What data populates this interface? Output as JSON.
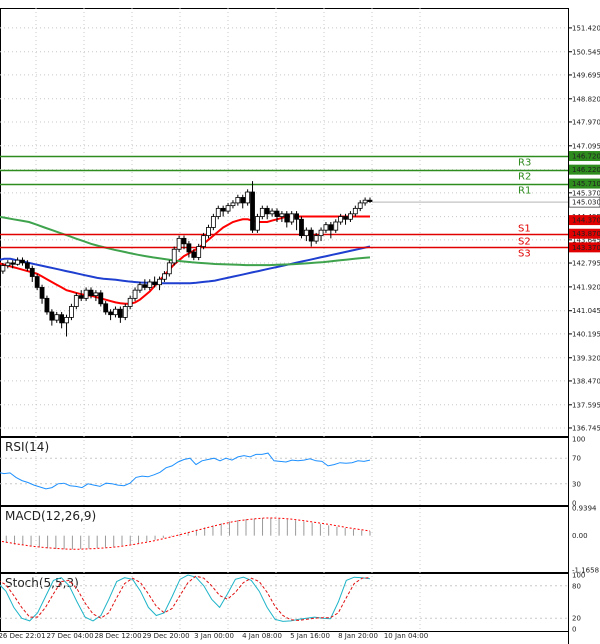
{
  "chart_data": [
    {
      "type": "candlestick",
      "y_ticks": [
        "151.420",
        "150.545",
        "149.695",
        "148.820",
        "147.970",
        "147.095",
        "146.220",
        "145.370",
        "144.495",
        "143.645",
        "142.795",
        "141.920",
        "141.045",
        "140.195",
        "139.320",
        "138.470",
        "137.595",
        "136.745"
      ],
      "ylim": [
        136.45,
        152.15
      ],
      "x_ticks": [
        "26 Dec 22:01",
        "27 Dec 04:00",
        "28 Dec 12:00",
        "29 Dec 20:00",
        "3 Jan 00:00",
        "4 Jan 08:00",
        "5 Jan 16:00",
        "8 Jan 20:00",
        "10 Jan 04:00"
      ],
      "candles": [
        [
          142.6,
          142.3,
          142.7,
          142.2
        ],
        [
          142.5,
          142.7,
          142.8,
          142.4
        ],
        [
          142.7,
          142.8,
          142.9,
          142.6
        ],
        [
          142.8,
          142.75,
          142.9,
          142.6
        ],
        [
          142.75,
          142.9,
          143.0,
          142.7
        ],
        [
          142.9,
          142.8,
          143.0,
          142.7
        ],
        [
          142.8,
          142.6,
          142.9,
          142.5
        ],
        [
          142.6,
          142.3,
          142.7,
          142.1
        ],
        [
          142.3,
          141.9,
          142.4,
          141.8
        ],
        [
          141.9,
          141.5,
          142.0,
          141.3
        ],
        [
          141.5,
          141.0,
          141.6,
          140.9
        ],
        [
          141.0,
          140.7,
          141.1,
          140.5
        ],
        [
          140.7,
          140.9,
          141.0,
          140.6
        ],
        [
          140.9,
          140.6,
          141.0,
          140.4
        ],
        [
          140.6,
          140.8,
          140.9,
          140.1
        ],
        [
          140.8,
          141.2,
          141.3,
          140.7
        ],
        [
          141.2,
          141.6,
          141.7,
          141.1
        ],
        [
          141.6,
          141.5,
          141.8,
          141.4
        ],
        [
          141.5,
          141.8,
          141.9,
          141.4
        ],
        [
          141.8,
          141.6,
          141.9,
          141.5
        ],
        [
          141.6,
          141.7,
          141.8,
          141.4
        ],
        [
          141.7,
          141.3,
          141.8,
          141.2
        ],
        [
          141.3,
          141.0,
          141.4,
          140.9
        ],
        [
          141.0,
          140.9,
          141.1,
          140.7
        ],
        [
          140.9,
          141.1,
          141.2,
          140.8
        ],
        [
          141.1,
          140.8,
          141.2,
          140.6
        ],
        [
          140.8,
          141.2,
          141.3,
          140.7
        ],
        [
          141.2,
          141.5,
          141.6,
          141.1
        ],
        [
          141.5,
          141.8,
          141.9,
          141.4
        ],
        [
          141.8,
          142.0,
          142.1,
          141.7
        ],
        [
          142.0,
          141.9,
          142.2,
          141.8
        ],
        [
          141.9,
          142.1,
          142.2,
          141.8
        ],
        [
          142.1,
          142.0,
          142.3,
          141.9
        ],
        [
          142.0,
          142.2,
          142.3,
          141.8
        ],
        [
          142.2,
          142.4,
          142.5,
          142.1
        ],
        [
          142.4,
          142.8,
          142.9,
          142.3
        ],
        [
          142.8,
          143.3,
          143.4,
          142.7
        ],
        [
          143.3,
          143.7,
          143.8,
          143.2
        ],
        [
          143.7,
          143.5,
          143.8,
          143.3
        ],
        [
          143.5,
          143.2,
          143.6,
          143.0
        ],
        [
          143.2,
          143.0,
          143.3,
          142.9
        ],
        [
          143.0,
          143.4,
          143.5,
          142.9
        ],
        [
          143.4,
          143.8,
          143.9,
          143.3
        ],
        [
          143.8,
          144.1,
          144.2,
          143.7
        ],
        [
          144.1,
          144.5,
          144.6,
          144.0
        ],
        [
          144.5,
          144.8,
          144.9,
          144.4
        ],
        [
          144.8,
          144.7,
          144.9,
          144.5
        ],
        [
          144.7,
          144.9,
          145.0,
          144.6
        ],
        [
          144.9,
          145.0,
          145.1,
          144.8
        ],
        [
          145.0,
          145.2,
          145.3,
          144.9
        ],
        [
          145.2,
          145.0,
          145.3,
          144.8
        ],
        [
          145.0,
          145.4,
          145.5,
          144.9
        ],
        [
          145.4,
          144.0,
          145.8,
          143.9
        ],
        [
          144.0,
          144.5,
          144.6,
          143.9
        ],
        [
          144.5,
          144.8,
          144.9,
          144.4
        ],
        [
          144.8,
          144.6,
          144.9,
          144.4
        ],
        [
          144.6,
          144.7,
          144.8,
          144.5
        ],
        [
          144.7,
          144.5,
          144.8,
          144.3
        ],
        [
          144.5,
          144.6,
          144.7,
          144.3
        ],
        [
          144.6,
          144.3,
          144.7,
          144.1
        ],
        [
          144.3,
          144.6,
          144.7,
          144.2
        ],
        [
          144.6,
          144.4,
          144.7,
          144.0
        ],
        [
          144.4,
          143.8,
          144.5,
          143.7
        ],
        [
          143.8,
          144.0,
          144.1,
          143.6
        ],
        [
          144.0,
          143.6,
          144.1,
          143.4
        ],
        [
          143.6,
          143.8,
          143.9,
          143.5
        ],
        [
          143.8,
          144.0,
          144.1,
          143.6
        ],
        [
          144.0,
          144.2,
          144.3,
          143.9
        ],
        [
          144.2,
          144.0,
          144.3,
          143.7
        ],
        [
          144.0,
          144.3,
          144.4,
          143.9
        ],
        [
          144.3,
          144.5,
          144.6,
          144.2
        ],
        [
          144.5,
          144.4,
          144.6,
          144.2
        ],
        [
          144.4,
          144.6,
          144.7,
          144.3
        ],
        [
          144.6,
          144.8,
          144.9,
          144.5
        ],
        [
          144.8,
          145.0,
          145.1,
          144.7
        ],
        [
          145.0,
          145.1,
          145.2,
          144.9
        ],
        [
          145.1,
          145.05,
          145.2,
          145.0
        ]
      ],
      "series": [
        {
          "name": "",
          "color": "#ff0000",
          "values": [
            142.8,
            142.75,
            142.7,
            142.65,
            142.6,
            142.55,
            142.5,
            142.45,
            142.4,
            142.3,
            142.2,
            142.1,
            142.0,
            141.9,
            141.8,
            141.75,
            141.7,
            141.65,
            141.62,
            141.6,
            141.55,
            141.5,
            141.45,
            141.4,
            141.35,
            141.32,
            141.3,
            141.3,
            141.35,
            141.45,
            141.6,
            141.75,
            141.95,
            142.15,
            142.35,
            142.55,
            142.75,
            142.9,
            143.05,
            143.15,
            143.25,
            143.35,
            143.5,
            143.65,
            143.8,
            143.95,
            144.1,
            144.2,
            144.3,
            144.35,
            144.4,
            144.4,
            144.35,
            144.3,
            144.3,
            144.3,
            144.35,
            144.4,
            144.45,
            144.5,
            144.5,
            144.5,
            144.5,
            144.5,
            144.5,
            144.5,
            144.5,
            144.5,
            144.5,
            144.5,
            144.5,
            144.5,
            144.5,
            144.5,
            144.5,
            144.5,
            144.5
          ]
        },
        {
          "name": "",
          "color": "#1e3fcf",
          "values": [
            142.9,
            142.95,
            142.95,
            142.9,
            142.85,
            142.8,
            142.75,
            142.7,
            142.65,
            142.6,
            142.55,
            142.5,
            142.45,
            142.4,
            142.35,
            142.3,
            142.25,
            142.22,
            142.2,
            142.18,
            142.15,
            142.12,
            142.1,
            142.08,
            142.07,
            142.06,
            142.05,
            142.05,
            142.05,
            142.05,
            142.05,
            142.05,
            142.07,
            142.1,
            142.12,
            142.15,
            142.2,
            142.25,
            142.3,
            142.35,
            142.4,
            142.45,
            142.5,
            142.55,
            142.6,
            142.65,
            142.7,
            142.75,
            142.8,
            142.85,
            142.9,
            142.95,
            143.0,
            143.05,
            143.1,
            143.15,
            143.2,
            143.25,
            143.3,
            143.35,
            143.4
          ]
        },
        {
          "name": "",
          "color": "#3fa34d",
          "values": [
            144.5,
            144.45,
            144.4,
            144.35,
            144.3,
            144.2,
            144.1,
            144.0,
            143.9,
            143.8,
            143.7,
            143.6,
            143.5,
            143.42,
            143.35,
            143.28,
            143.22,
            143.16,
            143.1,
            143.05,
            143.0,
            142.96,
            142.92,
            142.88,
            142.85,
            142.82,
            142.8,
            142.78,
            142.76,
            142.75,
            142.74,
            142.73,
            142.72,
            142.72,
            142.72,
            142.72,
            142.73,
            142.74,
            142.75,
            142.77,
            142.79,
            142.81,
            142.83,
            142.86,
            142.89,
            142.92,
            142.95,
            142.98,
            143.0
          ]
        }
      ],
      "levels": [
        {
          "label": "R3",
          "value": "146.720",
          "color": "#2e8b1e",
          "text_color": "#2e8b1e",
          "label_pos": "below"
        },
        {
          "label": "R2",
          "value": "146.220",
          "color": "#2e8b1e",
          "text_color": "#2e8b1e",
          "label_pos": "below"
        },
        {
          "label": "R1",
          "value": "145.710",
          "color": "#2e8b1e",
          "text_color": "#2e8b1e",
          "label_pos": "below"
        },
        {
          "label": "S1",
          "value": "143.870",
          "color": "#e10000",
          "text_color": "#e10000",
          "label_pos": "above"
        },
        {
          "label": "S2",
          "value": "143.370",
          "color": "#e10000",
          "text_color": "#e10000",
          "label_pos": "above"
        },
        {
          "label": "S3",
          "value": "143.370",
          "color": "#e10000",
          "text_color": "#e10000",
          "label_pos": "below"
        }
      ],
      "red_tags": [
        "144.370",
        "143.870",
        "143.370"
      ],
      "current_price": "145.030",
      "current_level": "144.370",
      "grid": true
    },
    {
      "type": "line",
      "title": "RSI(14)",
      "y_ticks": [
        "100",
        "70",
        "30",
        "0"
      ],
      "ylim": [
        0,
        100
      ],
      "series": [
        {
          "name": "RSI(14)",
          "color": "#1e90ff",
          "values": [
            48,
            46,
            47,
            40,
            35,
            32,
            28,
            25,
            22,
            24,
            30,
            31,
            27,
            26,
            24,
            30,
            28,
            26,
            31,
            30,
            28,
            27,
            31,
            40,
            42,
            41,
            44,
            48,
            55,
            58,
            64,
            68,
            70,
            60,
            66,
            68,
            70,
            66,
            70,
            67,
            72,
            74,
            72,
            76,
            76,
            78,
            66,
            65,
            64,
            67,
            66,
            67,
            69,
            66,
            65,
            58,
            60,
            63,
            62,
            63,
            66,
            65,
            67
          ]
        }
      ]
    },
    {
      "type": "bar",
      "title": "MACD(12,26,9)",
      "y_ticks": [
        "0.9394",
        "0.00",
        "-1.1658"
      ],
      "ylim": [
        -1.1658,
        0.9394
      ],
      "values": [
        -0.2,
        -0.25,
        -0.3,
        -0.33,
        -0.36,
        -0.4,
        -0.43,
        -0.45,
        -0.46,
        -0.46,
        -0.45,
        -0.44,
        -0.42,
        -0.4,
        -0.37,
        -0.33,
        -0.29,
        -0.25,
        -0.2,
        -0.14,
        -0.08,
        -0.02,
        0.05,
        0.12,
        0.2,
        0.28,
        0.35,
        0.42,
        0.48,
        0.53,
        0.56,
        0.58,
        0.6,
        0.6,
        0.58,
        0.55,
        0.52,
        0.48,
        0.44,
        0.4,
        0.35,
        0.3,
        0.26,
        0.22,
        0.18,
        0.15
      ],
      "signal": [
        -0.18,
        -0.22,
        -0.27,
        -0.31,
        -0.35,
        -0.38,
        -0.41,
        -0.43,
        -0.45,
        -0.46,
        -0.46,
        -0.45,
        -0.44,
        -0.42,
        -0.4,
        -0.37,
        -0.33,
        -0.29,
        -0.24,
        -0.19,
        -0.13,
        -0.07,
        0.0,
        0.07,
        0.14,
        0.21,
        0.28,
        0.35,
        0.41,
        0.47,
        0.52,
        0.55,
        0.58,
        0.6,
        0.6,
        0.59,
        0.57,
        0.54,
        0.5,
        0.46,
        0.42,
        0.38,
        0.33,
        0.28,
        0.24,
        0.2,
        0.16
      ],
      "color": "#ff0000"
    },
    {
      "type": "line",
      "title": "Stoch(5,5,3)",
      "y_ticks": [
        "100",
        "80",
        "20",
        "0"
      ],
      "ylim": [
        0,
        100
      ],
      "series": [
        {
          "name": "%K",
          "color": "#1eb4c8",
          "values": [
            85,
            70,
            40,
            20,
            15,
            30,
            60,
            90,
            95,
            80,
            50,
            22,
            15,
            25,
            55,
            88,
            95,
            92,
            70,
            40,
            25,
            30,
            60,
            92,
            100,
            96,
            80,
            55,
            40,
            65,
            92,
            96,
            90,
            70,
            40,
            18,
            14,
            15,
            18,
            20,
            22,
            20,
            19,
            50,
            90,
            96,
            95,
            93
          ]
        },
        {
          "name": "%D",
          "color": "#e01010",
          "values": [
            90,
            82,
            62,
            40,
            22,
            22,
            40,
            65,
            88,
            90,
            74,
            48,
            28,
            20,
            30,
            58,
            84,
            94,
            86,
            65,
            42,
            30,
            38,
            62,
            86,
            98,
            94,
            80,
            62,
            55,
            68,
            86,
            94,
            88,
            68,
            42,
            25,
            17,
            16,
            18,
            20,
            21,
            21,
            30,
            58,
            84,
            94,
            95
          ]
        }
      ]
    }
  ]
}
